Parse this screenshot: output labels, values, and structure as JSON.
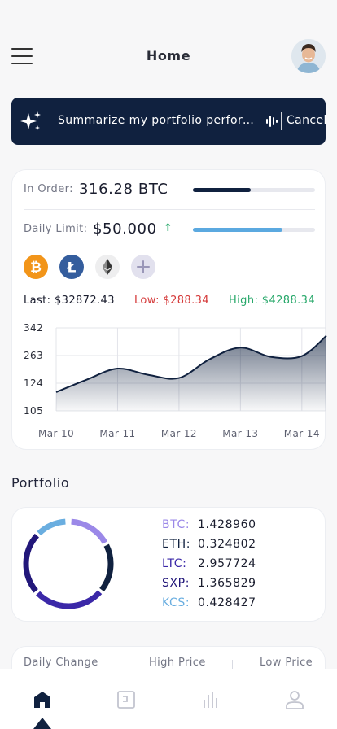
{
  "header": {
    "title": "Home"
  },
  "assistant": {
    "prompt": "Summarize my portfolio performance",
    "cancel_label": "Cancel"
  },
  "market": {
    "in_order_label": "In Order:",
    "in_order_value": "316.28 BTC",
    "in_order_progress": 0.47,
    "daily_limit_label": "Daily Limit:",
    "daily_limit_value": "$50.000",
    "daily_limit_progress": 0.73,
    "coins": [
      "bitcoin-icon",
      "litecoin-icon",
      "ethereum-icon",
      "add-coin-icon"
    ],
    "last": "Last: $32872.43",
    "low": "Low: $288.34",
    "high": "High: $4288.34",
    "colors": {
      "low": "#d53a3a",
      "high": "#27a86a",
      "accent": "#10213f",
      "limit": "#5ba9e0"
    }
  },
  "chart_data": {
    "type": "area",
    "categories": [
      "Mar 10",
      "Mar 11",
      "Mar 12",
      "Mar 13",
      "Mar 14"
    ],
    "y_ticks": [
      "342",
      "263",
      "124",
      "105"
    ],
    "x": [
      0,
      0.5,
      1,
      1.5,
      2,
      2.5,
      3,
      3.5,
      4,
      4.4
    ],
    "values": [
      150,
      190,
      225,
      205,
      195,
      255,
      292,
      262,
      265,
      330
    ],
    "ylim": [
      90,
      355
    ],
    "grid": true
  },
  "portfolio": {
    "title": "Portfolio",
    "items": [
      {
        "symbol": "BTC:",
        "amount": "1.428960",
        "color": "#9b88e8"
      },
      {
        "symbol": "ETH:",
        "amount": "0.324802",
        "color": "#10213f"
      },
      {
        "symbol": "LTC:",
        "amount": "2.957724",
        "color": "#3b28a8"
      },
      {
        "symbol": "SXP:",
        "amount": "1.365829",
        "color": "#22177a"
      },
      {
        "symbol": "KCS:",
        "amount": "0.428427",
        "color": "#6aaee0"
      }
    ]
  },
  "stats": {
    "daily_change": "Daily Change",
    "high_price": "High Price",
    "low_price": "Low Price"
  },
  "nav": [
    "home-icon",
    "wallet-icon",
    "market-icon",
    "profile-icon"
  ]
}
